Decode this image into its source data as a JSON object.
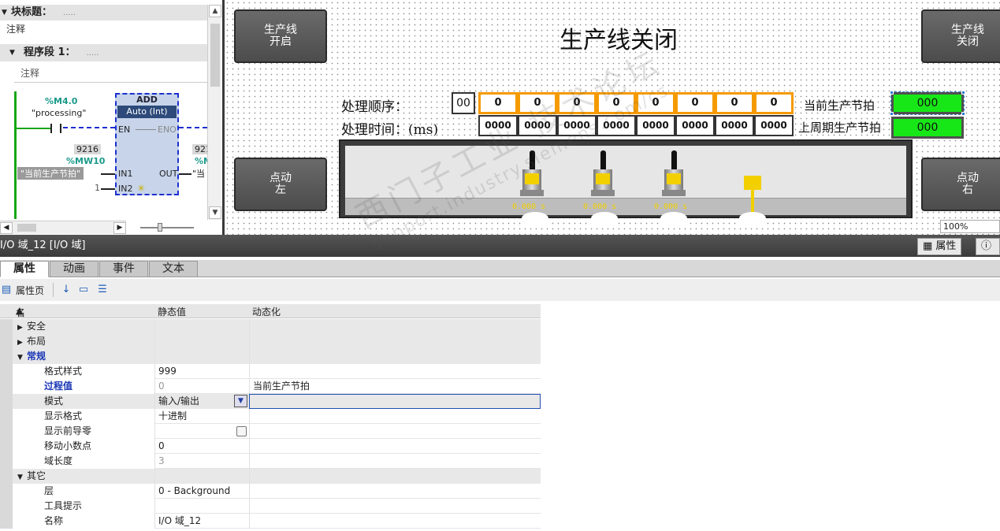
{
  "ladder": {
    "block_title_label": "块标题：",
    "block_title_dots": ".....",
    "block_comment": "注释",
    "network_label": "程序段 1：",
    "network_dots": ".....",
    "network_comment": "注释",
    "contact_address": "%M4.0",
    "contact_symbol": "\"processing\"",
    "en_label": "EN",
    "eno_label": "ENO",
    "add_title": "ADD",
    "add_type": "Auto (Int)",
    "in1_value": "9216",
    "in1_address": "%MW10",
    "in1_symbol": "\"当前生产节拍\"",
    "in1_label": "IN1",
    "in2_const": "1",
    "in2_label": "IN2",
    "out_label": "OUT",
    "out_value": "921",
    "out_address": "%M",
    "out_symbol": "\"当",
    "scroll_up": "▲",
    "scroll_down": "▼",
    "scroll_left": "◀",
    "scroll_right": "▶"
  },
  "hmi": {
    "title": "生产线关闭",
    "btn_start": [
      "生产线",
      "开启"
    ],
    "btn_stop": [
      "生产线",
      "关闭"
    ],
    "btn_jog_left": [
      "点动",
      "左"
    ],
    "btn_jog_right": [
      "点动",
      "右"
    ],
    "seq_label": "处理顺序：",
    "time_label": "处理时间：(ms)",
    "seq_index": "00",
    "seq_values": [
      "0",
      "0",
      "0",
      "0",
      "0",
      "0",
      "0",
      "0"
    ],
    "time_values": [
      "0000",
      "0000",
      "0000",
      "0000",
      "0000",
      "0000",
      "0000",
      "0000"
    ],
    "current_cycle_label": "当前生产节拍",
    "current_cycle_value": "000",
    "last_cycle_label": "上周期生产节拍",
    "last_cycle_value": "000",
    "timers": [
      "0.000  s",
      "0.000  s",
      "0.000  s"
    ],
    "zoom": "100%"
  },
  "panel": {
    "title": "I/O 域_12 [I/O 域]",
    "right_tab_properties": "属性",
    "right_tab_info": "信",
    "tabs": [
      "属性",
      "动画",
      "事件",
      "文本"
    ],
    "toolbar_properties_page": "属性页",
    "col_name": "名称",
    "col_static": "静态值",
    "col_dynamic": "动态化",
    "rows": [
      {
        "kind": "cat",
        "expanded": false,
        "name": "安全",
        "static": "",
        "dynamic": ""
      },
      {
        "kind": "cat",
        "expanded": false,
        "name": "布局",
        "static": "",
        "dynamic": ""
      },
      {
        "kind": "cat",
        "expanded": true,
        "name": "常规",
        "static": "",
        "dynamic": "",
        "style": "blue"
      },
      {
        "kind": "prop",
        "name": "格式样式",
        "static": "999",
        "dynamic": ""
      },
      {
        "kind": "prop",
        "name": "过程值",
        "static": "0",
        "dynamic": "当前生产节拍",
        "style": "blue",
        "static_grey": true
      },
      {
        "kind": "prop",
        "name": "模式",
        "static": "输入/输出",
        "dynamic": "",
        "dropdown": true,
        "selected": true
      },
      {
        "kind": "prop",
        "name": "显示格式",
        "static": "十进制",
        "dynamic": ""
      },
      {
        "kind": "prop",
        "name": "显示前导零",
        "static": "",
        "dynamic": "",
        "checkbox": true
      },
      {
        "kind": "prop",
        "name": "移动小数点",
        "static": "0",
        "dynamic": ""
      },
      {
        "kind": "prop",
        "name": "域长度",
        "static": "3",
        "dynamic": "",
        "static_grey": true
      },
      {
        "kind": "cat",
        "expanded": true,
        "name": "其它",
        "static": "",
        "dynamic": ""
      },
      {
        "kind": "prop",
        "name": "层",
        "static": "0 - Background",
        "dynamic": ""
      },
      {
        "kind": "prop",
        "name": "工具提示",
        "static": "",
        "dynamic": ""
      },
      {
        "kind": "prop",
        "name": "名称",
        "static": "I/O 域_12",
        "dynamic": ""
      }
    ]
  },
  "watermark": {
    "line1": "西门子工业  技术论坛",
    "line2": "support.industry.siemens.com/cs"
  },
  "colors": {
    "orange_frame": "#f59a00",
    "green_display": "#17e717",
    "ladder_green": "#15a615",
    "ladder_blue": "#1c2fd0",
    "sensor_yellow": "#f2d000"
  }
}
